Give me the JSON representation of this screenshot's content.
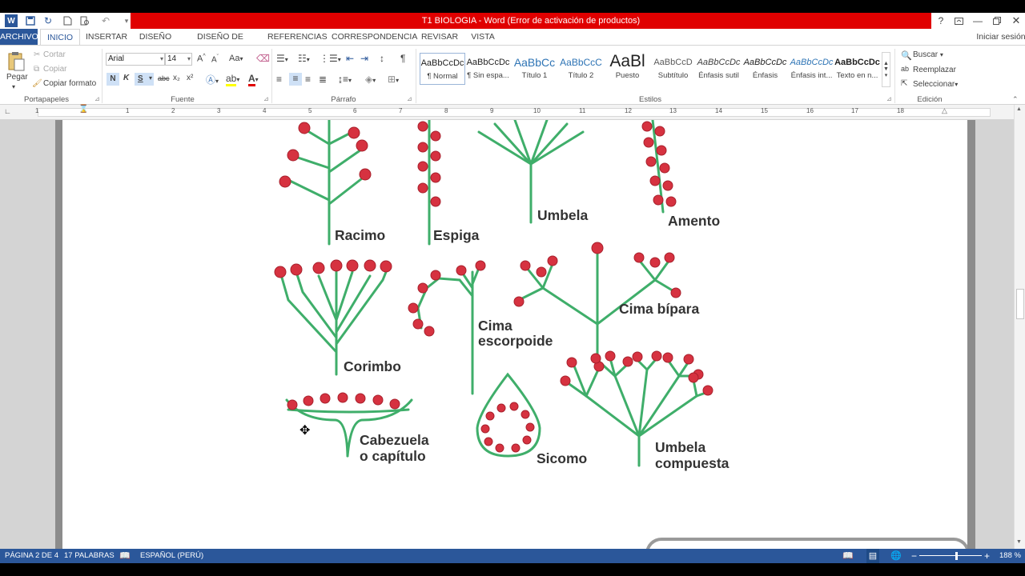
{
  "window": {
    "title": "T1 BIOLOGIA -  Word (Error de activación de productos)",
    "help": "?"
  },
  "tabs": [
    "ARCHIVO",
    "INICIO",
    "INSERTAR",
    "DISEÑO",
    "DISEÑO DE PÁGINA",
    "REFERENCIAS",
    "CORRESPONDENCIA",
    "REVISAR",
    "VISTA"
  ],
  "signin": "Iniciar sesión",
  "clipboard": {
    "paste": "Pegar",
    "cut": "Cortar",
    "copy": "Copiar",
    "format_painter": "Copiar formato",
    "group": "Portapapeles"
  },
  "font": {
    "name": "Arial",
    "size": "14",
    "case": "Aa",
    "bold": "N",
    "italic": "K",
    "underline": "S",
    "strike": "abc",
    "subscript": "x₂",
    "superscript": "x²",
    "group": "Fuente"
  },
  "paragraph": {
    "group": "Párrafo"
  },
  "styles": {
    "group": "Estilos",
    "items": [
      {
        "preview": "AaBbCcDc",
        "name": "¶ Normal"
      },
      {
        "preview": "AaBbCcDc",
        "name": "¶ Sin espa..."
      },
      {
        "preview": "AaBbCc",
        "name": "Título 1"
      },
      {
        "preview": "AaBbCcC",
        "name": "Título 2"
      },
      {
        "preview": "AaBl",
        "name": "Puesto"
      },
      {
        "preview": "AaBbCcD",
        "name": "Subtítulo"
      },
      {
        "preview": "AaBbCcDc",
        "name": "Énfasis sutil"
      },
      {
        "preview": "AaBbCcDc",
        "name": "Énfasis"
      },
      {
        "preview": "AaBbCcDc",
        "name": "Énfasis int..."
      },
      {
        "preview": "AaBbCcDc",
        "name": "Texto en n..."
      }
    ]
  },
  "editing": {
    "find": "Buscar",
    "replace": "Reemplazar",
    "select": "Seleccionar",
    "group": "Edición"
  },
  "ruler": [
    "1",
    "1",
    "2",
    "3",
    "4",
    "5",
    "6",
    "7",
    "8",
    "9",
    "10",
    "11",
    "12",
    "13",
    "14",
    "15",
    "16",
    "17",
    "18"
  ],
  "figure_labels": {
    "racimo": "Racimo",
    "espiga": "Espiga",
    "umbela": "Umbela",
    "amento": "Amento",
    "corimbo": "Corimbo",
    "cima_escorpioide": [
      "Cima",
      "escorpoide"
    ],
    "cima_bipara": "Cima bípara",
    "cabezuela": [
      "Cabezuela",
      "o capítulo"
    ],
    "sicomo": "Sicomo",
    "umbela_compuesta": [
      "Umbela",
      "compuesta"
    ]
  },
  "status": {
    "page": "PÁGINA 2 DE 4",
    "words": "17 PALABRAS",
    "language": "ESPAÑOL (PERÚ)",
    "zoom": "188 %"
  },
  "colors": {
    "accent": "#2b579a",
    "title_bar": "#e00000",
    "flower": "#d63240",
    "stem": "#3fae6a"
  }
}
